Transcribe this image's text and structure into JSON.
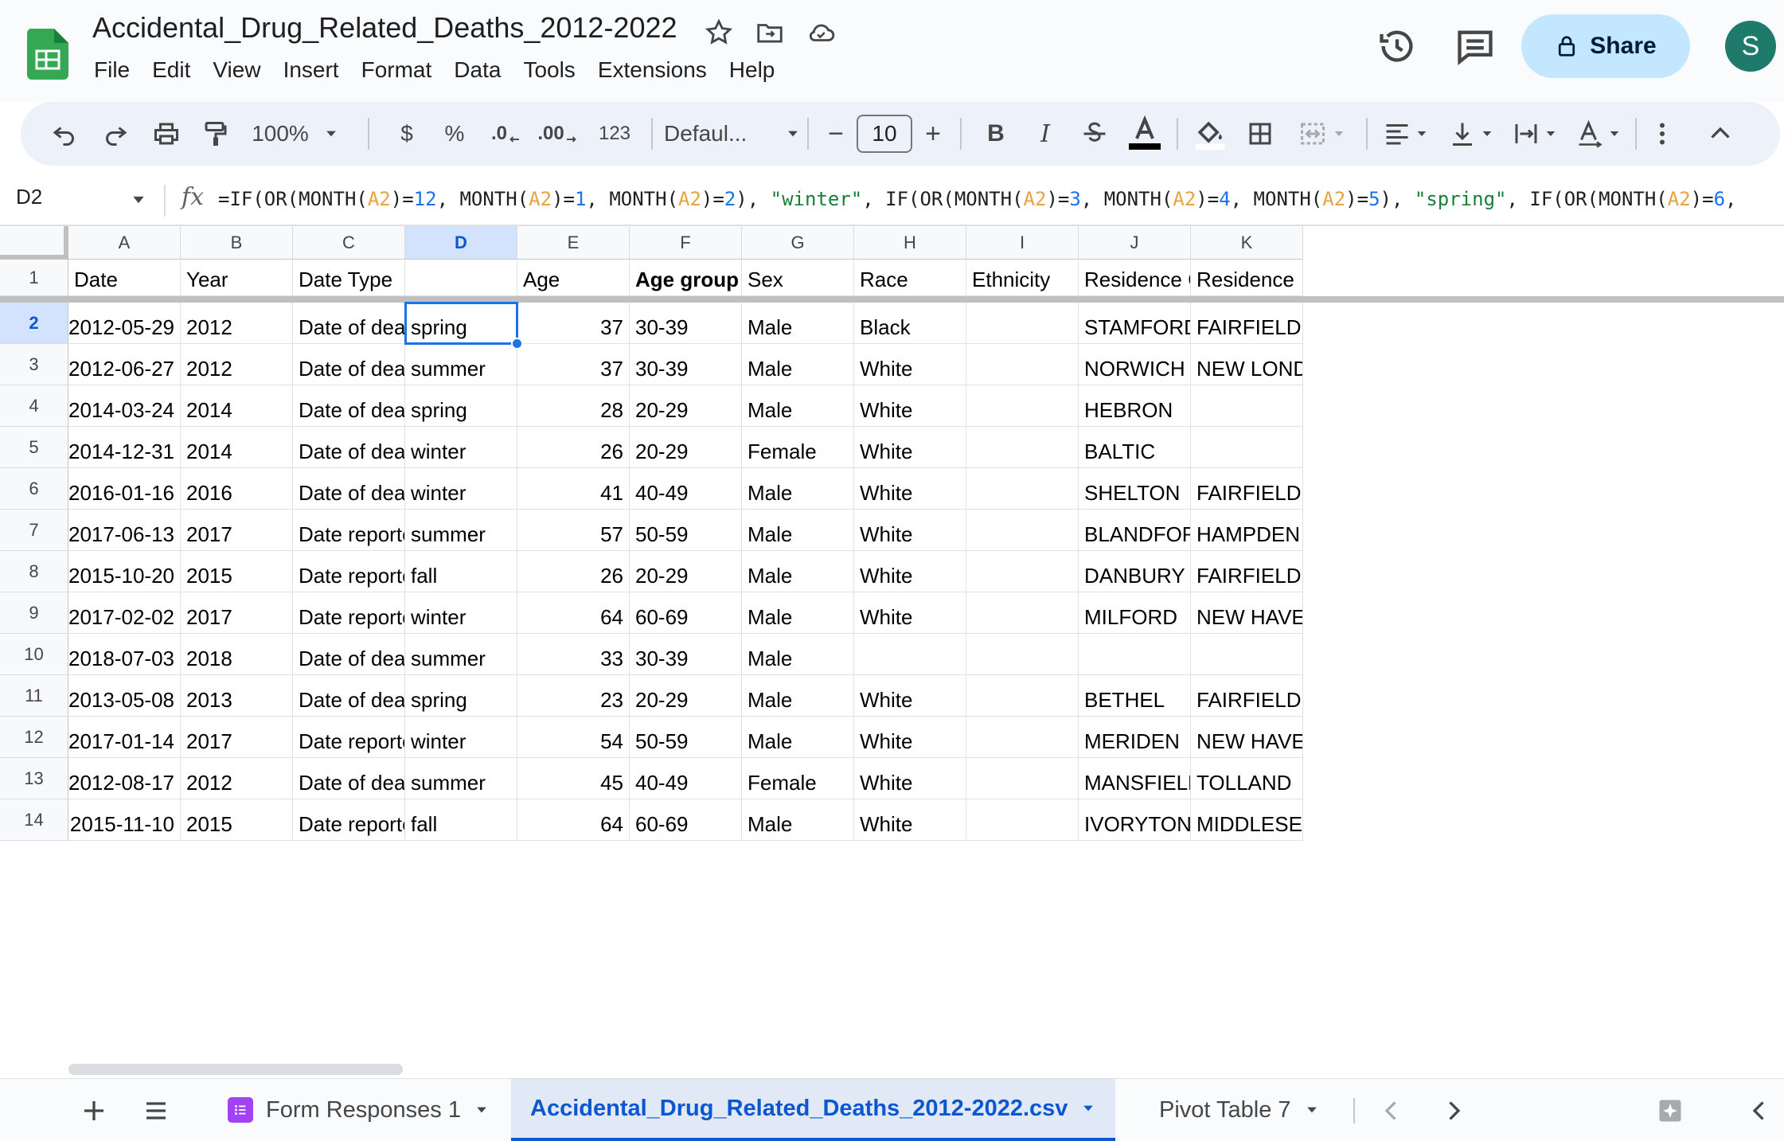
{
  "doc": {
    "title": "Accidental_Drug_Related_Deaths_2012-2022"
  },
  "menu": [
    "File",
    "Edit",
    "View",
    "Insert",
    "Format",
    "Data",
    "Tools",
    "Extensions",
    "Help"
  ],
  "header": {
    "share_label": "Share",
    "avatar_initial": "S"
  },
  "toolbar": {
    "zoom": "100%",
    "currency": "$",
    "percent": "%",
    "dec_decrease": ".0",
    "dec_increase": ".00",
    "number_format": "123",
    "font": "Defaul...",
    "font_size": "10",
    "minus": "−",
    "plus": "+",
    "bold": "B",
    "italic": "I"
  },
  "formula_bar": {
    "cell_ref": "D2",
    "fx": "fx",
    "formula_parts": [
      {
        "t": "=IF(OR(MONTH(",
        "c": ""
      },
      {
        "t": "A2",
        "c": "ref"
      },
      {
        "t": ")=",
        "c": ""
      },
      {
        "t": "12",
        "c": "num"
      },
      {
        "t": ", MONTH(",
        "c": ""
      },
      {
        "t": "A2",
        "c": "ref"
      },
      {
        "t": ")=",
        "c": ""
      },
      {
        "t": "1",
        "c": "num"
      },
      {
        "t": ", MONTH(",
        "c": ""
      },
      {
        "t": "A2",
        "c": "ref"
      },
      {
        "t": ")=",
        "c": ""
      },
      {
        "t": "2",
        "c": "num"
      },
      {
        "t": "), ",
        "c": ""
      },
      {
        "t": "\"winter\"",
        "c": "str"
      },
      {
        "t": ", IF(OR(MONTH(",
        "c": ""
      },
      {
        "t": "A2",
        "c": "ref"
      },
      {
        "t": ")=",
        "c": ""
      },
      {
        "t": "3",
        "c": "num"
      },
      {
        "t": ", MONTH(",
        "c": ""
      },
      {
        "t": "A2",
        "c": "ref"
      },
      {
        "t": ")=",
        "c": ""
      },
      {
        "t": "4",
        "c": "num"
      },
      {
        "t": ", MONTH(",
        "c": ""
      },
      {
        "t": "A2",
        "c": "ref"
      },
      {
        "t": ")=",
        "c": ""
      },
      {
        "t": "5",
        "c": "num"
      },
      {
        "t": "), ",
        "c": ""
      },
      {
        "t": "\"spring\"",
        "c": "str"
      },
      {
        "t": ", IF(OR(MONTH(",
        "c": ""
      },
      {
        "t": "A2",
        "c": "ref"
      },
      {
        "t": ")=",
        "c": ""
      },
      {
        "t": "6",
        "c": "num"
      },
      {
        "t": ",",
        "c": ""
      }
    ]
  },
  "sheet": {
    "selected_cell": "D2",
    "columns": [
      "A",
      "B",
      "C",
      "D",
      "E",
      "F",
      "G",
      "H",
      "I",
      "J",
      "K"
    ],
    "header_row": [
      "Date",
      "Year",
      "Date Type",
      "",
      "Age",
      "Age group",
      "Sex",
      "Race",
      "Ethnicity",
      "Residence City",
      "Residence"
    ],
    "rows": [
      {
        "num": "2",
        "cells": [
          "2012-05-29",
          "2012",
          "Date of death",
          "spring",
          "37",
          "30-39",
          "Male",
          "Black",
          "",
          "STAMFORD",
          "FAIRFIELD"
        ]
      },
      {
        "num": "3",
        "cells": [
          "2012-06-27",
          "2012",
          "Date of death",
          "summer",
          "37",
          "30-39",
          "Male",
          "White",
          "",
          "NORWICH",
          "NEW LONDON"
        ]
      },
      {
        "num": "4",
        "cells": [
          "2014-03-24",
          "2014",
          "Date of death",
          "spring",
          "28",
          "20-29",
          "Male",
          "White",
          "",
          "HEBRON",
          ""
        ]
      },
      {
        "num": "5",
        "cells": [
          "2014-12-31",
          "2014",
          "Date of death",
          "winter",
          "26",
          "20-29",
          "Female",
          "White",
          "",
          "BALTIC",
          ""
        ]
      },
      {
        "num": "6",
        "cells": [
          "2016-01-16",
          "2016",
          "Date of death",
          "winter",
          "41",
          "40-49",
          "Male",
          "White",
          "",
          "SHELTON",
          "FAIRFIELD"
        ]
      },
      {
        "num": "7",
        "cells": [
          "2017-06-13",
          "2017",
          "Date reported",
          "summer",
          "57",
          "50-59",
          "Male",
          "White",
          "",
          "BLANDFORD",
          "HAMPDEN"
        ]
      },
      {
        "num": "8",
        "cells": [
          "2015-10-20",
          "2015",
          "Date reported",
          "fall",
          "26",
          "20-29",
          "Male",
          "White",
          "",
          "DANBURY",
          "FAIRFIELD"
        ]
      },
      {
        "num": "9",
        "cells": [
          "2017-02-02",
          "2017",
          "Date reported",
          "winter",
          "64",
          "60-69",
          "Male",
          "White",
          "",
          "MILFORD",
          "NEW HAVEN"
        ]
      },
      {
        "num": "10",
        "cells": [
          "2018-07-03",
          "2018",
          "Date of death",
          "summer",
          "33",
          "30-39",
          "Male",
          "",
          "",
          "",
          ""
        ]
      },
      {
        "num": "11",
        "cells": [
          "2013-05-08",
          "2013",
          "Date of death",
          "spring",
          "23",
          "20-29",
          "Male",
          "White",
          "",
          "BETHEL",
          "FAIRFIELD"
        ]
      },
      {
        "num": "12",
        "cells": [
          "2017-01-14",
          "2017",
          "Date reported",
          "winter",
          "54",
          "50-59",
          "Male",
          "White",
          "",
          "MERIDEN",
          "NEW HAVEN"
        ]
      },
      {
        "num": "13",
        "cells": [
          "2012-08-17",
          "2012",
          "Date of death",
          "summer",
          "45",
          "40-49",
          "Female",
          "White",
          "",
          "MANSFIELD",
          "TOLLAND"
        ]
      },
      {
        "num": "14",
        "cells": [
          "2015-11-10",
          "2015",
          "Date reported",
          "fall",
          "64",
          "60-69",
          "Male",
          "White",
          "",
          "IVORYTON",
          "MIDDLESEX"
        ]
      }
    ]
  },
  "tabs": [
    {
      "label": "Form Responses 1",
      "active": false
    },
    {
      "label": "Accidental_Drug_Related_Deaths_2012-2022.csv",
      "active": true
    },
    {
      "label": "Pivot Table 7",
      "active": false
    }
  ],
  "colors": {
    "accent": "#1a73e8",
    "share_bg": "#c2e7ff",
    "sheets_green": "#0f9d58",
    "avatar": "#1e7a6b"
  }
}
